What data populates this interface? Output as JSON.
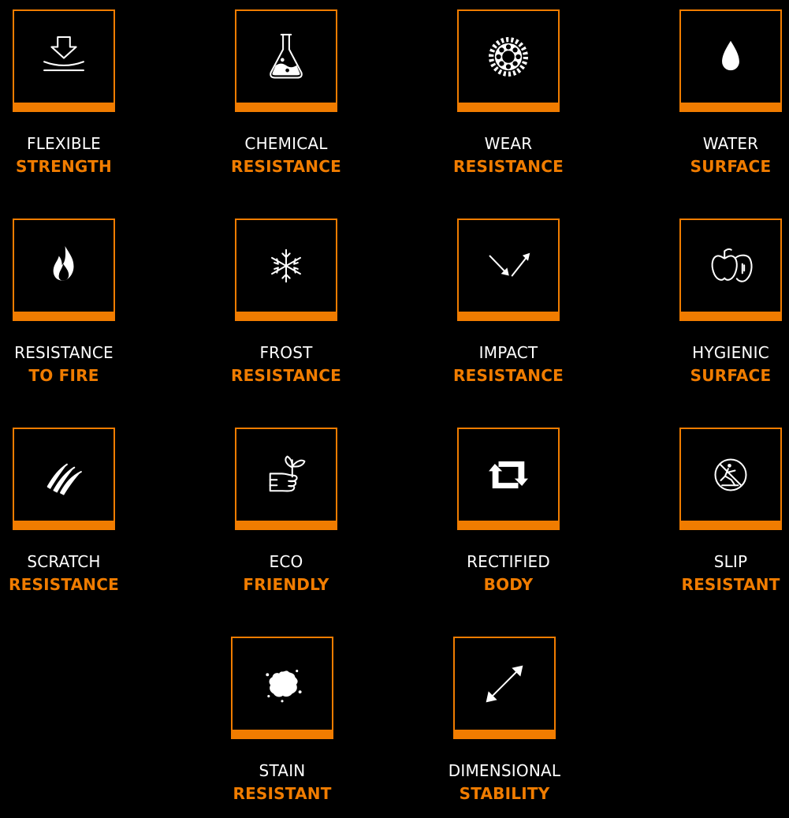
{
  "features": [
    {
      "line1": "FLEXIBLE",
      "line2": "STRENGTH",
      "icon": "flexible-strength-icon"
    },
    {
      "line1": "CHEMICAL",
      "line2": "RESISTANCE",
      "icon": "chemical-flask-icon"
    },
    {
      "line1": "WEAR",
      "line2": "RESISTANCE",
      "icon": "gear-wear-icon"
    },
    {
      "line1": "WATER",
      "line2": "SURFACE",
      "icon": "water-drop-icon"
    },
    {
      "line1": "RESISTANCE",
      "line2": "TO FIRE",
      "icon": "fire-icon"
    },
    {
      "line1": "FROST",
      "line2": "RESISTANCE",
      "icon": "snowflake-icon"
    },
    {
      "line1": "IMPACT",
      "line2": "RESISTANCE",
      "icon": "impact-arrows-icon"
    },
    {
      "line1": "HYGIENIC",
      "line2": "SURFACE",
      "icon": "apple-hygiene-icon"
    },
    {
      "line1": "SCRATCH",
      "line2": "RESISTANCE",
      "icon": "scratch-claw-icon"
    },
    {
      "line1": "ECO",
      "line2": "FRIENDLY",
      "icon": "eco-hand-plant-icon"
    },
    {
      "line1": "RECTIFIED",
      "line2": "BODY",
      "icon": "rectified-arrows-icon"
    },
    {
      "line1": "SLIP",
      "line2": "RESISTANT",
      "icon": "no-slip-icon"
    },
    {
      "line1": "STAIN",
      "line2": "RESISTANT",
      "icon": "stain-splat-icon"
    },
    {
      "line1": "DIMENSIONAL",
      "line2": "STABILITY",
      "icon": "dimension-arrow-icon"
    }
  ],
  "colors": {
    "background": "#000000",
    "accent": "#f07c00",
    "text": "#ffffff"
  }
}
